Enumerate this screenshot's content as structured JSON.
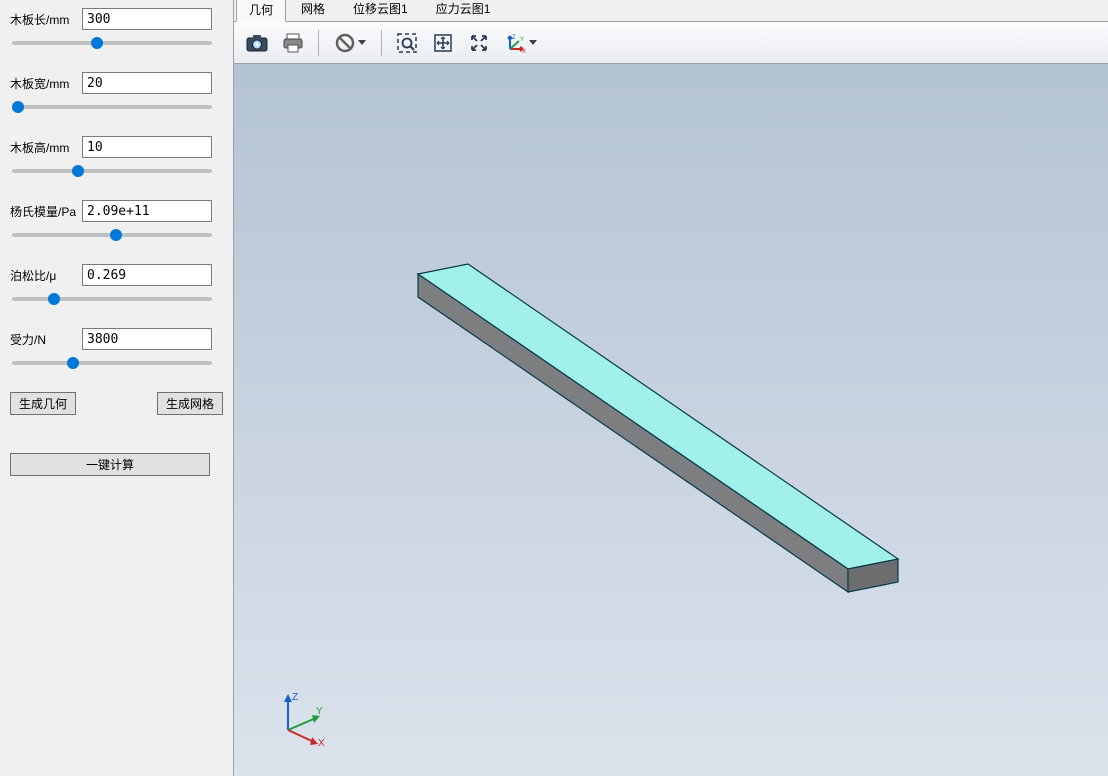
{
  "params": {
    "length": {
      "label": "木板长/mm",
      "value": "300"
    },
    "width": {
      "label": "木板宽/mm",
      "value": "20"
    },
    "height": {
      "label": "木板高/mm",
      "value": "10"
    },
    "youngs": {
      "label": "杨氏模量/Pa",
      "value": "2.09e+11"
    },
    "poisson": {
      "label": "泊松比/μ",
      "value": "0.269"
    },
    "force": {
      "label": "受力/N",
      "value": "3800"
    }
  },
  "sliders": {
    "length": 42,
    "width": 0,
    "height": 32,
    "youngs": 52,
    "poisson": 19,
    "force": 29
  },
  "buttons": {
    "gen_geometry": "生成几何",
    "gen_mesh": "生成网格",
    "one_click": "一键计算"
  },
  "tabs": {
    "geometry": "几何",
    "mesh": "网格",
    "disp": "位移云图1",
    "stress": "应力云图1"
  },
  "triad": {
    "x": "X",
    "y": "Y",
    "z": "Z"
  }
}
